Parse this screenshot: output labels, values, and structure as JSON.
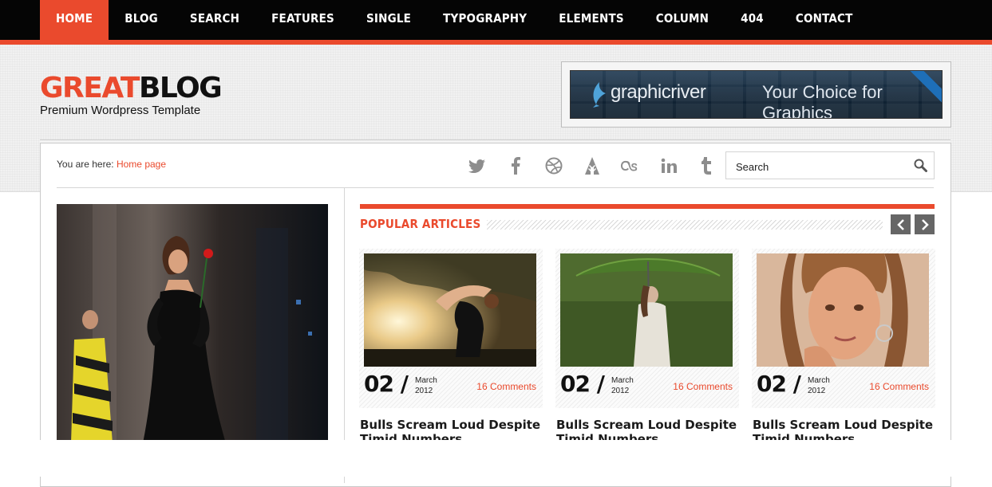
{
  "nav": {
    "items": [
      {
        "label": "HOME",
        "active": true
      },
      {
        "label": "BLOG"
      },
      {
        "label": "SEARCH"
      },
      {
        "label": "FEATURES"
      },
      {
        "label": "SINGLE"
      },
      {
        "label": "TYPOGRAPHY"
      },
      {
        "label": "ELEMENTS"
      },
      {
        "label": "COLUMN"
      },
      {
        "label": "404"
      },
      {
        "label": "CONTACT"
      }
    ]
  },
  "logo": {
    "part1": "GREAT",
    "part2": "BLOG",
    "tagline": "Premium Wordpress Template"
  },
  "banner": {
    "brand": "graphicriver",
    "slogan": "Your Choice for Graphics"
  },
  "breadcrumb": {
    "prefix": "You are here:",
    "link": "Home page"
  },
  "social": [
    "twitter-icon",
    "facebook-icon",
    "dribbble-icon",
    "forrst-icon",
    "lastfm-icon",
    "linkedin-icon",
    "tumblr-icon"
  ],
  "search": {
    "placeholder": "Search"
  },
  "popular": {
    "title": "POPULAR ARTICLES",
    "articles": [
      {
        "day": "02 /",
        "month": "March",
        "year": "2012",
        "comments": "16 Comments",
        "title": "Bulls Scream Loud Despite Timid Numbers"
      },
      {
        "day": "02 /",
        "month": "March",
        "year": "2012",
        "comments": "16 Comments",
        "title": "Bulls Scream Loud Despite Timid Numbers"
      },
      {
        "day": "02 /",
        "month": "March",
        "year": "2012",
        "comments": "16 Comments",
        "title": "Bulls Scream Loud Despite Timid Numbers"
      }
    ]
  },
  "colors": {
    "accent": "#ea4a2d",
    "nav_bg": "#050505",
    "text": "#1a1a1a"
  }
}
